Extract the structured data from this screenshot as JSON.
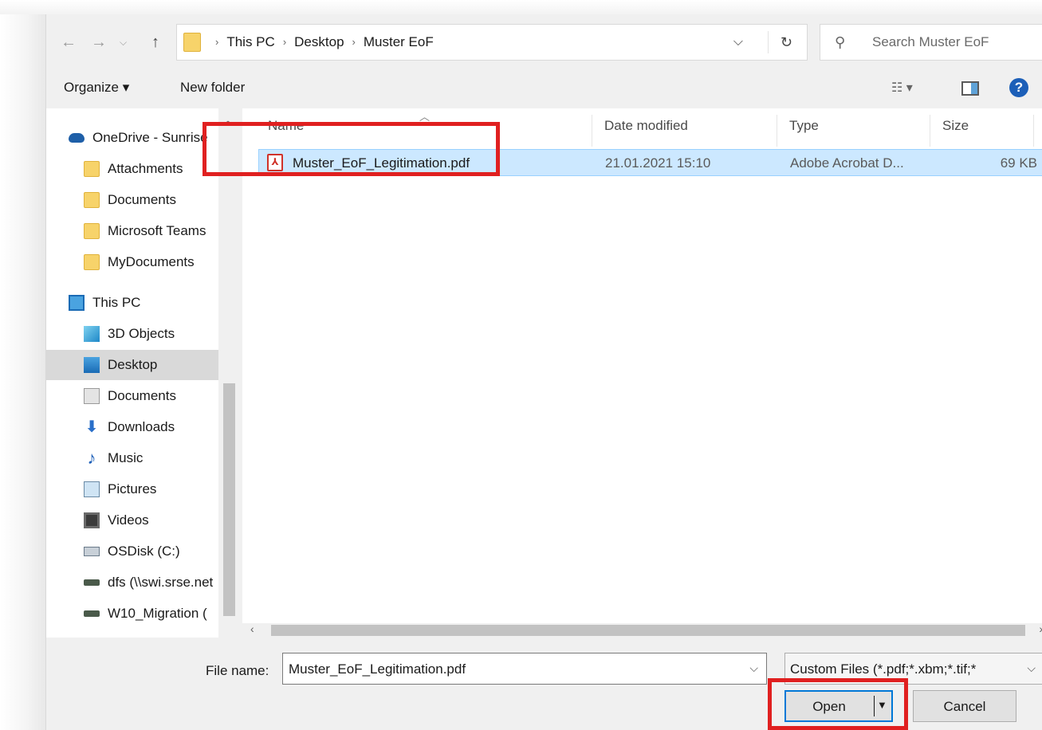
{
  "address": {
    "crumbs": [
      "This PC",
      "Desktop",
      "Muster EoF"
    ],
    "search_placeholder": "Search Muster EoF"
  },
  "toolbar": {
    "organize": "Organize ▾",
    "new_folder": "New folder"
  },
  "nav": {
    "items": [
      {
        "label": "OneDrive - Sunrise",
        "icon": "onedrive-icon"
      },
      {
        "label": "Attachments",
        "icon": "folder-icon"
      },
      {
        "label": "Documents",
        "icon": "folder-icon"
      },
      {
        "label": "Microsoft Teams",
        "icon": "folder-icon"
      },
      {
        "label": "MyDocuments",
        "icon": "folder-icon"
      },
      {
        "label": "This PC",
        "icon": "this-pc-icon"
      },
      {
        "label": "3D Objects",
        "icon": "3d-objects-icon"
      },
      {
        "label": "Desktop",
        "icon": "desktop-icon"
      },
      {
        "label": "Documents",
        "icon": "documents-icon"
      },
      {
        "label": "Downloads",
        "icon": "downloads-icon"
      },
      {
        "label": "Music",
        "icon": "music-icon"
      },
      {
        "label": "Pictures",
        "icon": "pictures-icon"
      },
      {
        "label": "Videos",
        "icon": "videos-icon"
      },
      {
        "label": "OSDisk (C:)",
        "icon": "drive-icon"
      },
      {
        "label": "dfs (\\\\swi.srse.net",
        "icon": "network-drive-icon"
      },
      {
        "label": "W10_Migration (",
        "icon": "network-drive-icon"
      }
    ],
    "selected": "Desktop"
  },
  "columns": {
    "name": "Name",
    "date": "Date modified",
    "type": "Type",
    "size": "Size"
  },
  "files": [
    {
      "name": "Muster_EoF_Legitimation.pdf",
      "date": "21.01.2021 15:10",
      "type": "Adobe Acrobat D...",
      "size": "69 KB",
      "icon": "pdf-icon"
    }
  ],
  "bottom": {
    "file_name_label": "File name:",
    "file_name_value": "Muster_EoF_Legitimation.pdf",
    "filter": "Custom Files (*.pdf;*.xbm;*.tif;*",
    "open": "Open",
    "cancel": "Cancel"
  },
  "colors": {
    "highlight": "#e02020",
    "selection": "#cce8ff",
    "accent": "#0078d7"
  }
}
